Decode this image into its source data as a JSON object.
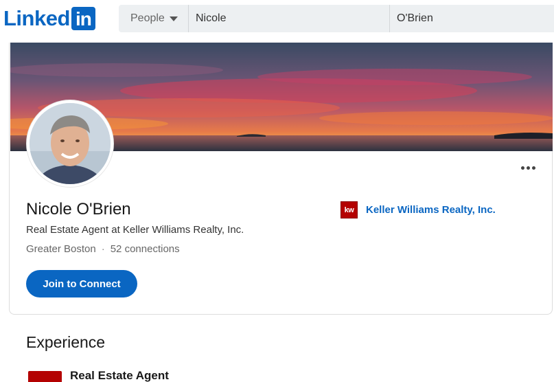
{
  "header": {
    "logo_word": "Linked",
    "logo_box": "in",
    "search": {
      "type_label": "People",
      "first_name": "Nicole",
      "last_name": "O'Brien"
    }
  },
  "profile": {
    "name": "Nicole O'Brien",
    "headline": "Real Estate Agent at Keller Williams Realty, Inc.",
    "location": "Greater Boston",
    "separator": "·",
    "connections": "52 connections",
    "join_button": "Join to Connect",
    "company": {
      "logo_text": "kw",
      "name": "Keller Williams Realty, Inc."
    }
  },
  "experience": {
    "heading": "Experience",
    "items": [
      {
        "role": "Real Estate Agent"
      }
    ]
  },
  "colors": {
    "brand": "#0a66c2",
    "company_logo": "#b40101"
  },
  "icons": {
    "more": "more-horizontal-icon",
    "dropdown": "caret-down-icon"
  }
}
